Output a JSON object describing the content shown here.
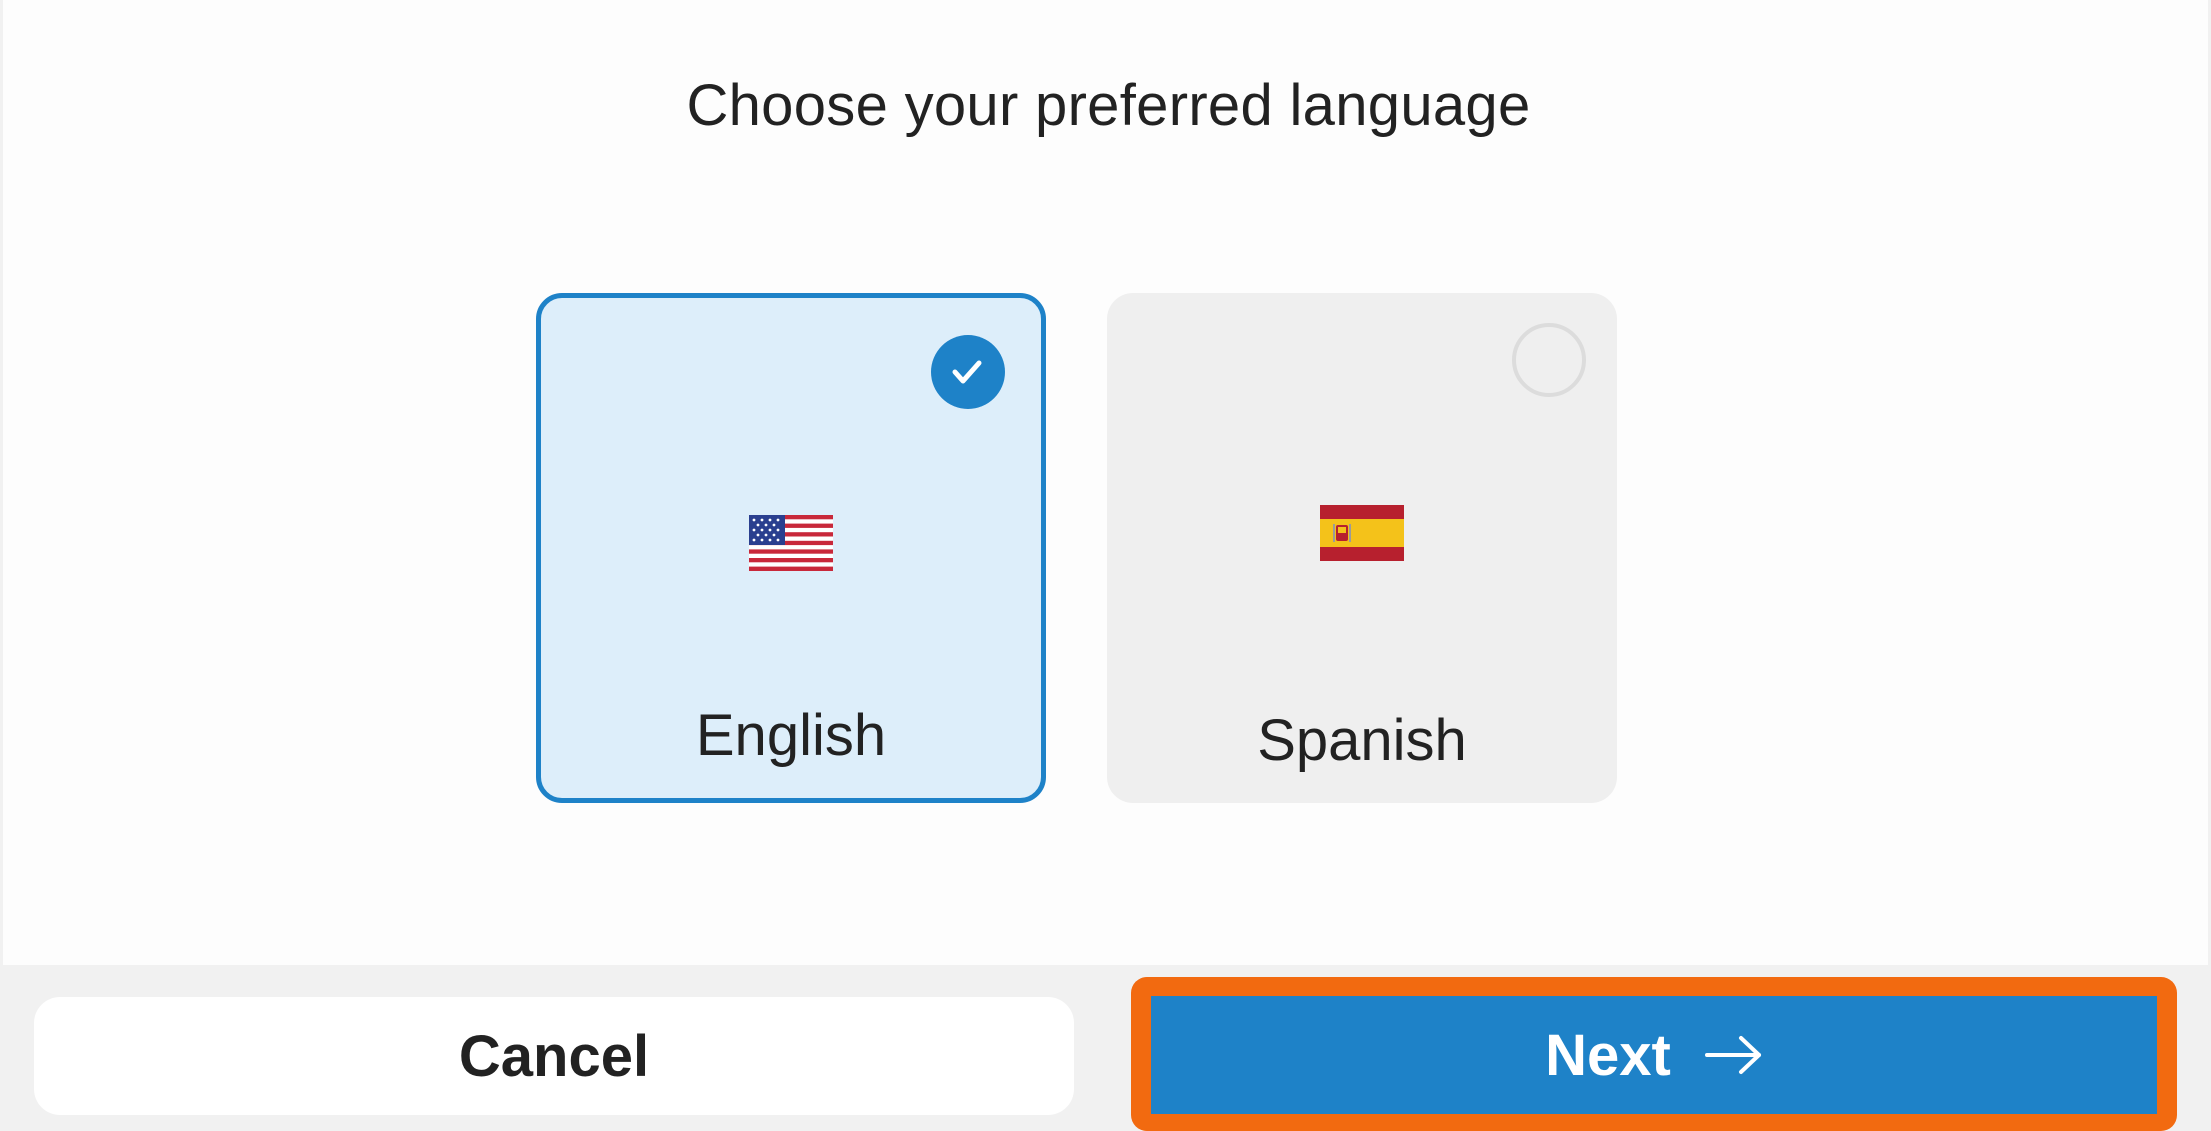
{
  "title": "Choose your preferred language",
  "languages": [
    {
      "label": "English",
      "flag": "us-flag-icon",
      "selected": true
    },
    {
      "label": "Spanish",
      "flag": "spain-flag-icon",
      "selected": false
    }
  ],
  "actions": {
    "cancel_label": "Cancel",
    "next_label": "Next",
    "next_icon": "arrow-right-icon"
  },
  "colors": {
    "accent": "#1e82c8",
    "selected_bg": "#ddeefa",
    "highlight": "#f26a10"
  }
}
